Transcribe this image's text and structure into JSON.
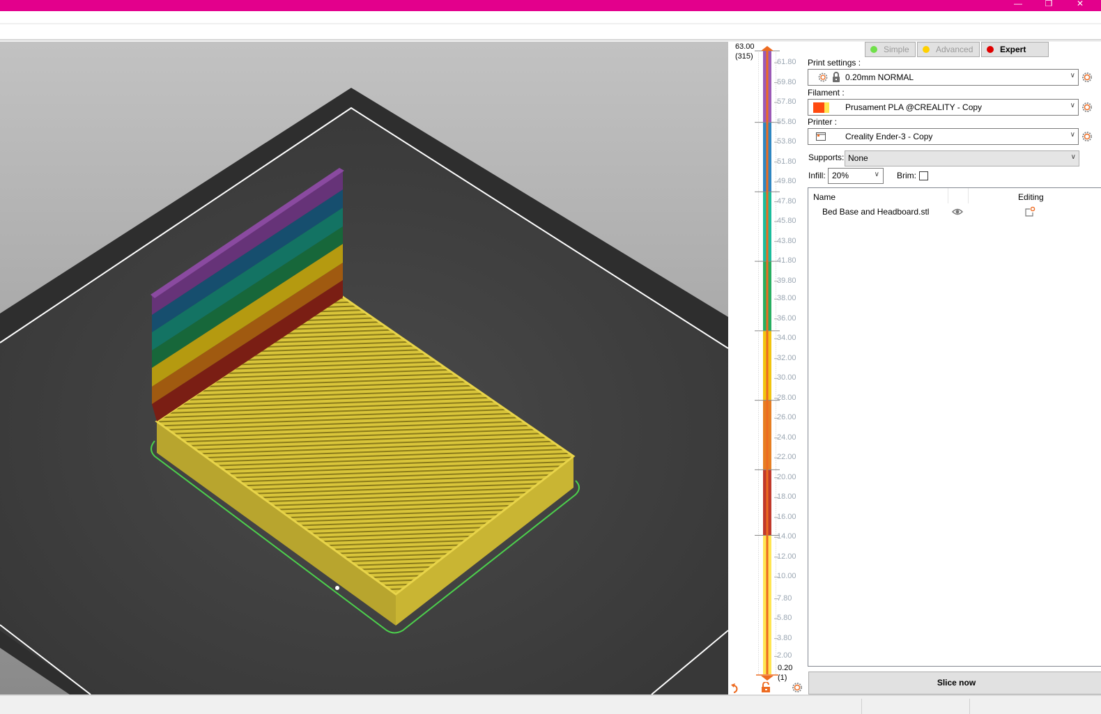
{
  "window": {
    "titlebar_color": "#e3008c",
    "controls": {
      "minimize": "—",
      "restore": "❐",
      "close": "✕"
    }
  },
  "layer_slider": {
    "top_value": "63.00",
    "top_layer": "(315)",
    "bottom_value": "0.20",
    "bottom_layer": "(1)",
    "tick_labels": [
      "61.80",
      "59.80",
      "57.80",
      "55.80",
      "53.80",
      "51.80",
      "49.80",
      "47.80",
      "45.80",
      "43.80",
      "41.80",
      "39.80",
      "38.00",
      "36.00",
      "34.00",
      "32.00",
      "30.00",
      "28.00",
      "26.00",
      "24.00",
      "22.00",
      "20.00",
      "18.00",
      "16.00",
      "14.00",
      "12.00",
      "10.00",
      "7.80",
      "5.80",
      "3.80",
      "2.00"
    ],
    "color_bands": [
      {
        "from": 55.8,
        "to": 63.0,
        "color": "#9b59b6"
      },
      {
        "from": 48.8,
        "to": 55.8,
        "color": "#2e86c1"
      },
      {
        "from": 41.8,
        "to": 48.8,
        "color": "#1abc9c"
      },
      {
        "from": 34.8,
        "to": 41.8,
        "color": "#27ae60"
      },
      {
        "from": 27.8,
        "to": 34.8,
        "color": "#f1c40f"
      },
      {
        "from": 20.8,
        "to": 27.8,
        "color": "#e67e22"
      },
      {
        "from": 14.2,
        "to": 20.8,
        "color": "#c0392b"
      },
      {
        "from": 0.2,
        "to": 14.2,
        "color": "#ffe552"
      }
    ],
    "handle_color": "#ed6b21"
  },
  "modes": [
    {
      "label": "Simple",
      "dot_color": "#70e04a",
      "active": false
    },
    {
      "label": "Advanced",
      "dot_color": "#ffd000",
      "active": false
    },
    {
      "label": "Expert",
      "dot_color": "#e00000",
      "active": true
    }
  ],
  "print_settings": {
    "label": "Print settings :",
    "value": "0.20mm NORMAL"
  },
  "filament": {
    "label": "Filament :",
    "value": "Prusament PLA @CREALITY - Copy",
    "swatch_colors": [
      "#ff4a0f",
      "#ffe552"
    ]
  },
  "printer": {
    "label": "Printer :",
    "value": "Creality Ender-3 - Copy"
  },
  "supports": {
    "label": "Supports:",
    "value": "None"
  },
  "infill": {
    "label": "Infill:",
    "value": "20%"
  },
  "brim": {
    "label": "Brim:",
    "checked": false
  },
  "object_list": {
    "columns": {
      "name": "Name",
      "editing": "Editing"
    },
    "items": [
      {
        "name": "Bed Base and Headboard.stl"
      }
    ]
  },
  "slice_button": "Slice now"
}
